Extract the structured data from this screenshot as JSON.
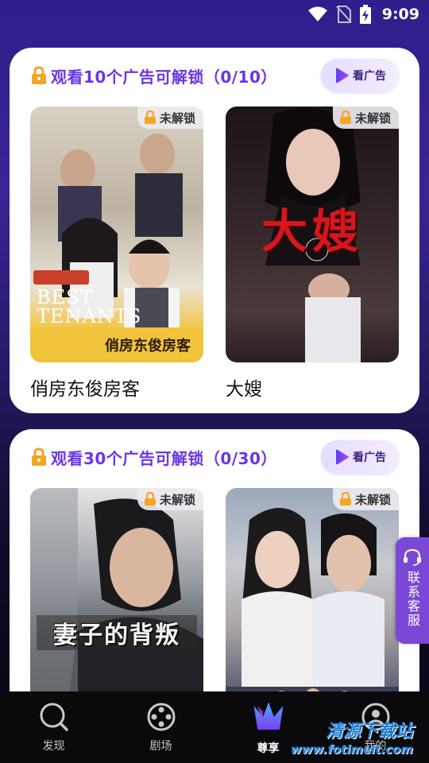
{
  "status_bar": {
    "time": "9:09",
    "icons": [
      "wifi-icon",
      "no-sim-icon",
      "battery-charging-icon"
    ]
  },
  "sections": [
    {
      "title": "观看10个广告可解锁（0/10）",
      "button_label": "看广告",
      "items": [
        {
          "caption": "俏房东俊房客",
          "badge": "未解锁",
          "poster_title": "俏房东俊房客",
          "poster_subtitle": "BEST TENANTS"
        },
        {
          "caption": "大嫂",
          "badge": "未解锁",
          "poster_title": "大嫂"
        }
      ]
    },
    {
      "title": "观看30个广告可解锁（0/30）",
      "button_label": "看广告",
      "items": [
        {
          "badge": "未解锁",
          "poster_title": "妻子的背叛"
        },
        {
          "badge": "未解锁"
        }
      ]
    }
  ],
  "side_tab": {
    "label": "联系客服"
  },
  "bottom_nav": [
    {
      "label": "发现",
      "icon": "discover-icon"
    },
    {
      "label": "剧场",
      "icon": "film-reel-icon"
    },
    {
      "label": "尊享",
      "icon": "vip-crown-icon",
      "active": true
    },
    {
      "label": "我的",
      "icon": "profile-icon"
    }
  ],
  "watermark": {
    "text": "清源下载站",
    "url": "www.fotimeit.com"
  },
  "colors": {
    "accent": "#6b35e6",
    "lock": "#f5a623",
    "side_tab": "#7a47d6"
  }
}
